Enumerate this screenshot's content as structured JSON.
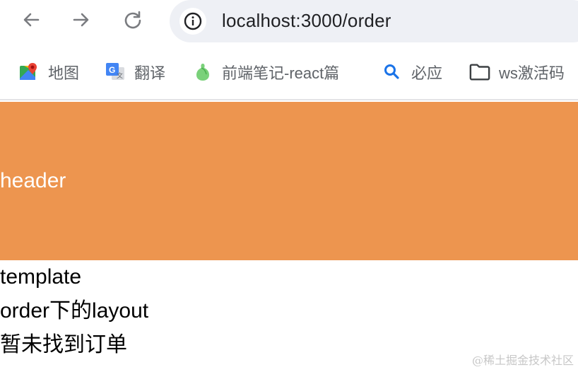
{
  "browser": {
    "url": "localhost:3000/order"
  },
  "bookmarks": [
    {
      "label": "地图",
      "icon": "google-maps-icon"
    },
    {
      "label": "翻译",
      "icon": "google-translate-icon"
    },
    {
      "label": "前端笔记-react篇",
      "icon": "notes-gourd-icon"
    },
    {
      "label": "必应",
      "icon": "search-icon"
    },
    {
      "label": "ws激活码",
      "icon": "folder-icon"
    }
  ],
  "page": {
    "header_text": "header",
    "lines": [
      "template",
      "order下的layout",
      "暂未找到订单"
    ]
  },
  "watermark": "@稀土掘金技术社区",
  "colors": {
    "header_bg": "#ed954f",
    "omnibox_bg": "#eef0f5"
  }
}
